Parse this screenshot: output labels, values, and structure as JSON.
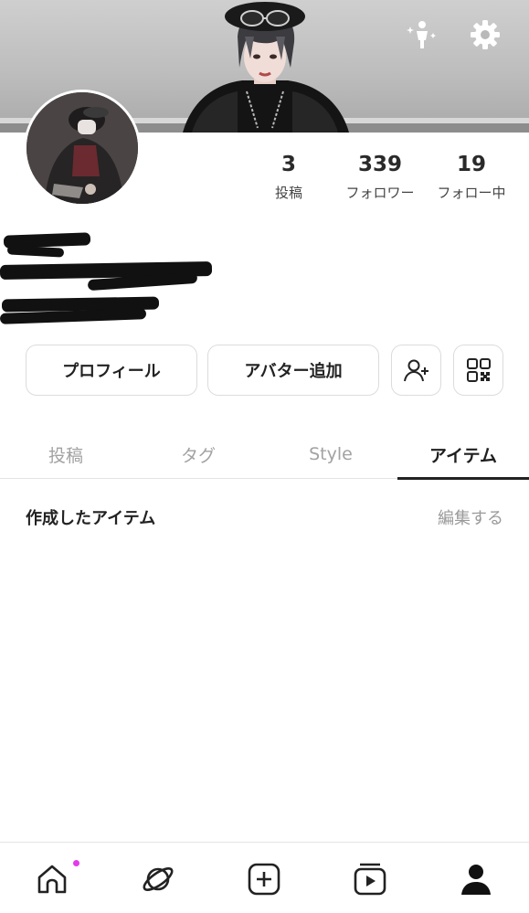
{
  "header": {
    "pose_icon": "pose-sparkle-icon",
    "settings_icon": "gear-icon"
  },
  "stats": {
    "posts": {
      "count": "3",
      "label": "投稿"
    },
    "followers": {
      "count": "339",
      "label": "フォロワー"
    },
    "following": {
      "count": "19",
      "label": "フォロー中"
    }
  },
  "actions": {
    "profile_label": "プロフィール",
    "add_avatar_label": "アバター追加",
    "add_friend_icon": "add-person-icon",
    "qr_icon": "qr-code-icon"
  },
  "tabs": [
    {
      "label": "投稿"
    },
    {
      "label": "タグ"
    },
    {
      "label": "Style"
    },
    {
      "label": "アイテム"
    }
  ],
  "section": {
    "title": "作成したアイテム",
    "action": "編集する"
  },
  "bottom_nav": {
    "items": [
      "home-icon",
      "planet-icon",
      "plus-square-icon",
      "video-stack-icon",
      "person-icon"
    ],
    "notification_color": "#e23ce8"
  }
}
